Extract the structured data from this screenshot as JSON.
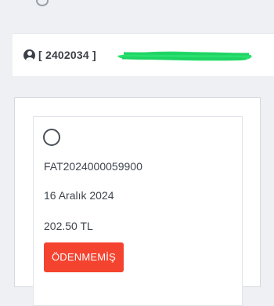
{
  "account": {
    "id_text": "[ 2402034 ]",
    "icon": "user-circle-icon"
  },
  "invoice": {
    "number": "FAT2024000059900",
    "date": "16 Aralık 2024",
    "amount": "202.50 TL",
    "status": "ÖDENMEMİŞ",
    "selected": false
  },
  "colors": {
    "status_unpaid": "#f4432f",
    "redaction": "#28e06e",
    "text": "#3f464e"
  }
}
